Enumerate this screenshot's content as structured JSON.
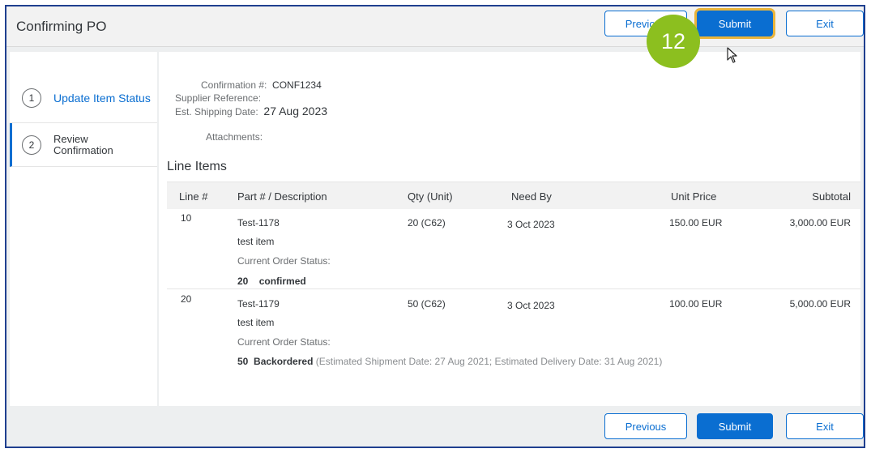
{
  "header": {
    "title": "Confirming PO",
    "previous_label": "Previous",
    "submit_label": "Submit",
    "exit_label": "Exit"
  },
  "callout": {
    "number": "12",
    "color": "#8cbf1f"
  },
  "steps": [
    {
      "number": "1",
      "label": "Update Item Status"
    },
    {
      "number": "2",
      "label_line1": "Review",
      "label_line2": "Confirmation"
    }
  ],
  "details": {
    "confirmation_label": "Confirmation #:",
    "confirmation_value": "CONF1234",
    "supplier_ref_label": "Supplier Reference:",
    "ship_date_label": "Est. Shipping Date:",
    "ship_date_value": "27 Aug 2023",
    "attachments_label": "Attachments:"
  },
  "line_items": {
    "title": "Line Items",
    "columns": [
      "Line #",
      "Part # / Description",
      "Qty (Unit)",
      "Need By",
      "Unit Price",
      "Subtotal"
    ],
    "status_label": "Current Order Status:",
    "rows": [
      {
        "line": "10",
        "part": "Test-1178",
        "description": "test item",
        "qty": "20 (C62)",
        "need_by": "3 Oct 2023",
        "unit_price": "150.00 EUR",
        "subtotal": "3,000.00 EUR",
        "status_qty": "20",
        "status_text": "confirmed",
        "status_note": ""
      },
      {
        "line": "20",
        "part": "Test-1179",
        "description": "test item",
        "qty": "50 (C62)",
        "need_by": "3 Oct 2023",
        "unit_price": "100.00 EUR",
        "subtotal": "5,000.00 EUR",
        "status_qty": "50",
        "status_text": "Backordered",
        "status_note": "(Estimated Shipment Date: 27 Aug 2021; Estimated Delivery Date: 31 Aug 2021)"
      }
    ]
  },
  "footer": {
    "previous_label": "Previous",
    "submit_label": "Submit",
    "exit_label": "Exit"
  },
  "colors": {
    "accent": "#0a6ed1",
    "highlight": "#e9b43b",
    "frame": "#1f3f8f"
  }
}
